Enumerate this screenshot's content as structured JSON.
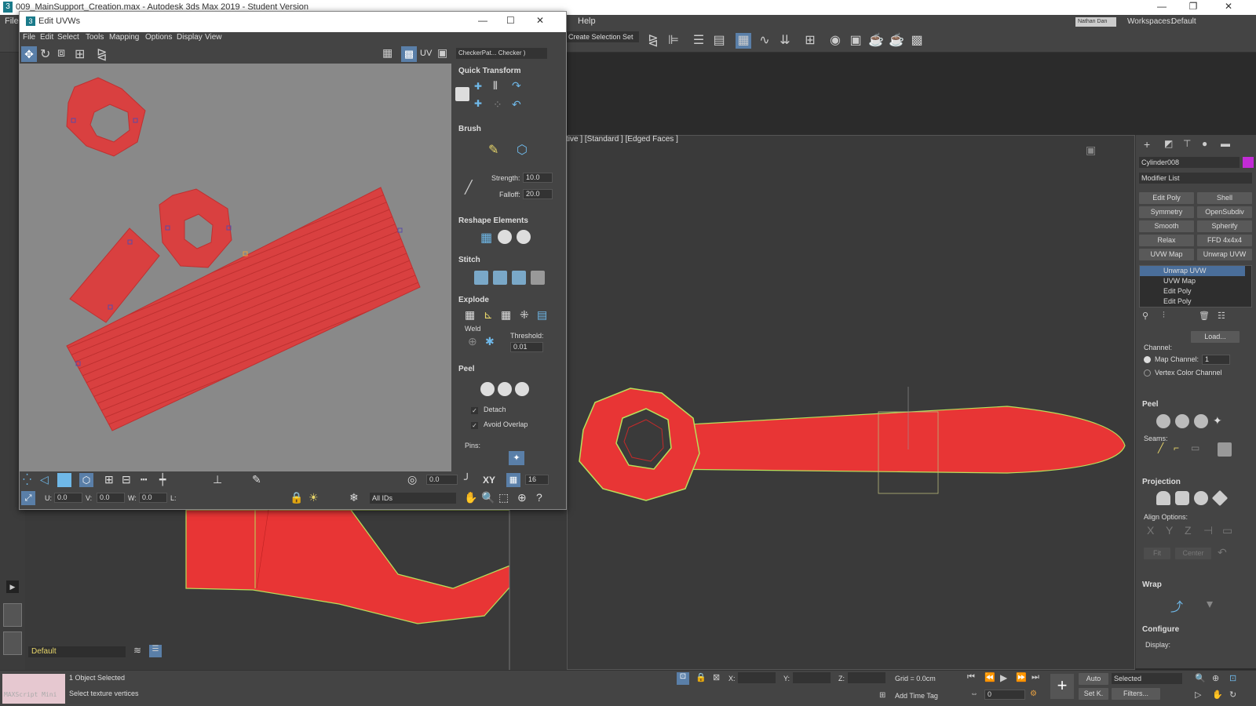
{
  "app": {
    "title": "009_MainSupport_Creation.max - Autodesk 3ds Max 2019 - Student Version",
    "menu": [
      "File",
      "Help"
    ],
    "workspaces_label": "Workspaces:",
    "workspace_value": "Default",
    "user": "Nathan Dan",
    "selection_set": "Create Selection Set"
  },
  "uvw_editor": {
    "title": "Edit UVWs",
    "menu": [
      "File",
      "Edit",
      "Select",
      "Tools",
      "Mapping",
      "Options",
      "Display",
      "View"
    ],
    "uv_label": "UV",
    "texture_dropdown": "CheckerPat... Checker )",
    "sections": {
      "quick_transform": "Quick Transform",
      "brush": "Brush",
      "strength_label": "Strength:",
      "strength_value": "10.0",
      "falloff_label": "Falloff:",
      "falloff_value": "20.0",
      "reshape": "Reshape Elements",
      "stitch": "Stitch",
      "explode": "Explode",
      "weld": "Weld",
      "threshold_label": "Threshold:",
      "threshold_value": "0.01",
      "peel": "Peel",
      "detach": "Detach",
      "avoid_overlap": "Avoid Overlap",
      "pins": "Pins:"
    },
    "bottom": {
      "u_label": "U:",
      "u_value": "0.0",
      "v_label": "V:",
      "v_value": "0.0",
      "w_label": "W:",
      "w_value": "0.0",
      "l_label": "L:",
      "angle_value": "0.0",
      "xy_label": "XY",
      "grid_value": "16",
      "ids_value": "All IDs"
    }
  },
  "viewport": {
    "label": "tive ]  [Standard ]  [Edged Faces ]"
  },
  "command_panel": {
    "object_name": "Cylinder008",
    "modifier_list": "Modifier List",
    "buttons": [
      "Edit Poly",
      "Shell",
      "Symmetry",
      "OpenSubdiv",
      "Smooth",
      "Spherify",
      "Relax",
      "FFD 4x4x4",
      "UVW Map",
      "Unwrap UVW"
    ],
    "stack": [
      "Unwrap UVW",
      "UVW Map",
      "Edit Poly",
      "Edit Poly"
    ],
    "load_button": "Load...",
    "channel_label": "Channel:",
    "map_channel_label": "Map Channel:",
    "map_channel_value": "1",
    "vertex_color_channel": "Vertex Color Channel",
    "peel_header": "Peel",
    "seams_label": "Seams:",
    "projection_header": "Projection",
    "align_options_label": "Align Options:",
    "align_axes": [
      "X",
      "Y",
      "Z"
    ],
    "fit_button": "Fit",
    "center_button": "Center",
    "wrap_header": "Wrap",
    "configure_header": "Configure",
    "display_label": "Display:"
  },
  "status": {
    "layer": "Default",
    "maxscript": "MAXScript Mini",
    "objects_selected": "1 Object Selected",
    "prompt": "Select texture vertices",
    "x_label": "X:",
    "y_label": "Y:",
    "z_label": "Z:",
    "grid": "Grid = 0.0cm",
    "add_time_tag": "Add Time Tag",
    "auto": "Auto",
    "selected": "Selected",
    "set_k": "Set K.",
    "filters": "Filters...",
    "frame": "0"
  },
  "colors": {
    "uv_red": "#d94040",
    "mesh_red": "#e83535",
    "edge_green": "#b8e05a"
  }
}
